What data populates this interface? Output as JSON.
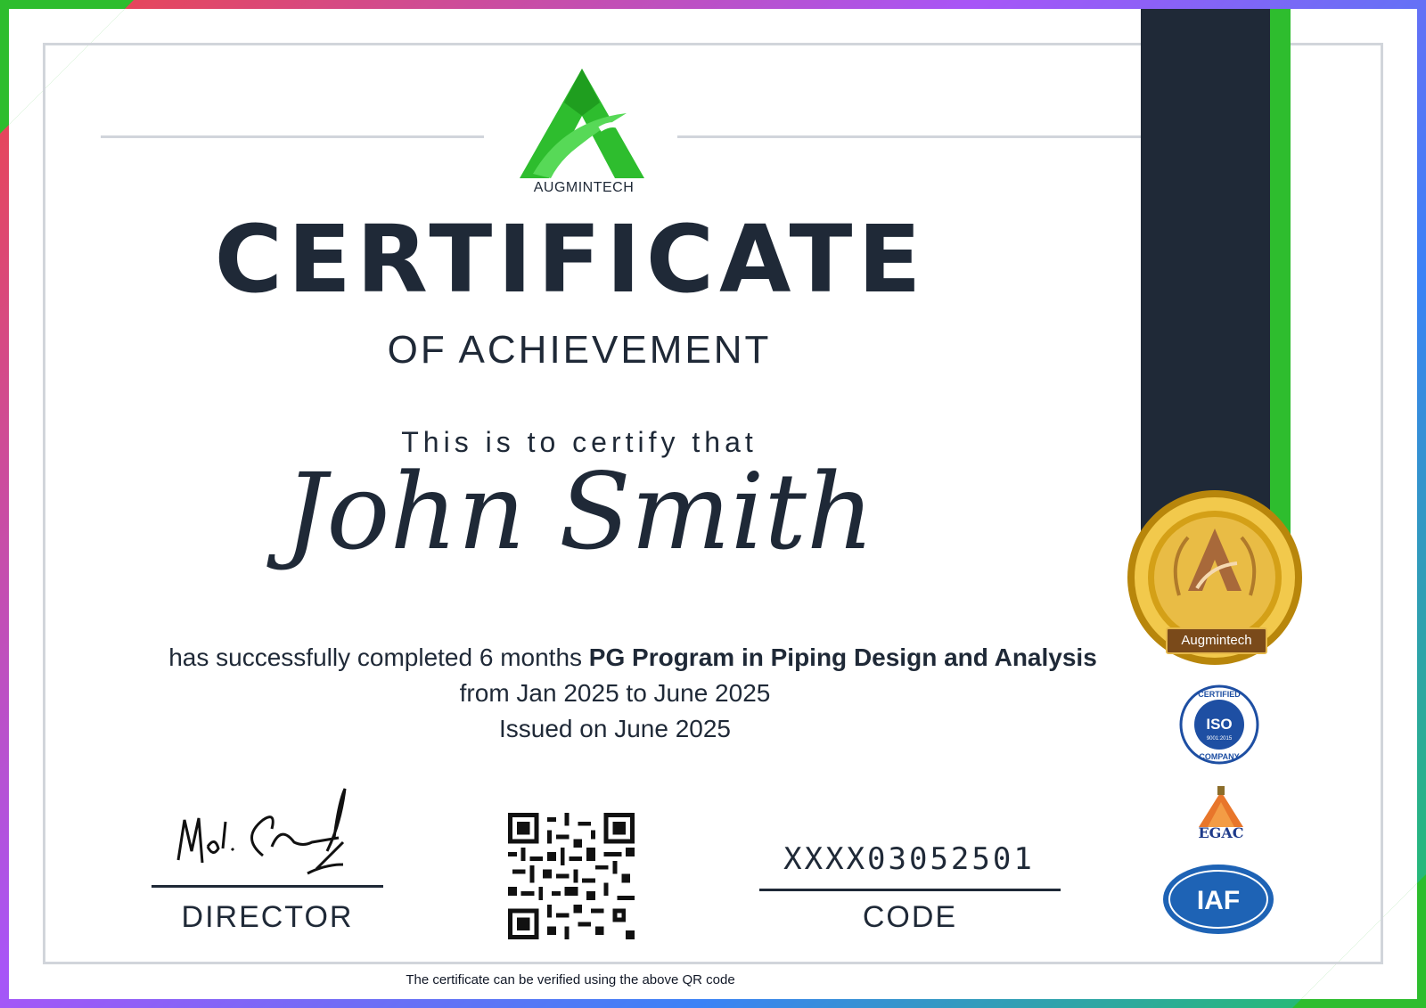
{
  "brand": {
    "logo_text": "AUGMINTECH"
  },
  "certificate": {
    "title": "CERTIFICATE",
    "subtitle": "OF ACHIEVEMENT",
    "certify_text": "This is to certify that",
    "recipient_name": "John Smith",
    "completion_prefix": "has successfully completed 6 months",
    "program_name": "PG Program in Piping Design and Analysis",
    "period": "from Jan 2025 to June 2025",
    "issued": "Issued on June 2025"
  },
  "signatory": {
    "role_label": "DIRECTOR"
  },
  "verification": {
    "code_value": "XXXX03052501",
    "code_label": "CODE",
    "footer_note": "The certificate can be verified using the above QR code"
  },
  "badges": {
    "medal_label": "Augmintech",
    "iso_top": "CERTIFIED",
    "iso_center": "ISO",
    "iso_number": "9001:2015",
    "iso_bottom": "COMPANY",
    "egac_label": "EGAC",
    "iaf_label": "IAF"
  },
  "colors": {
    "dark": "#1f2937",
    "accent_green": "#2ebd2e",
    "gold": "#d4a017",
    "iso_blue": "#1e4fa3"
  }
}
